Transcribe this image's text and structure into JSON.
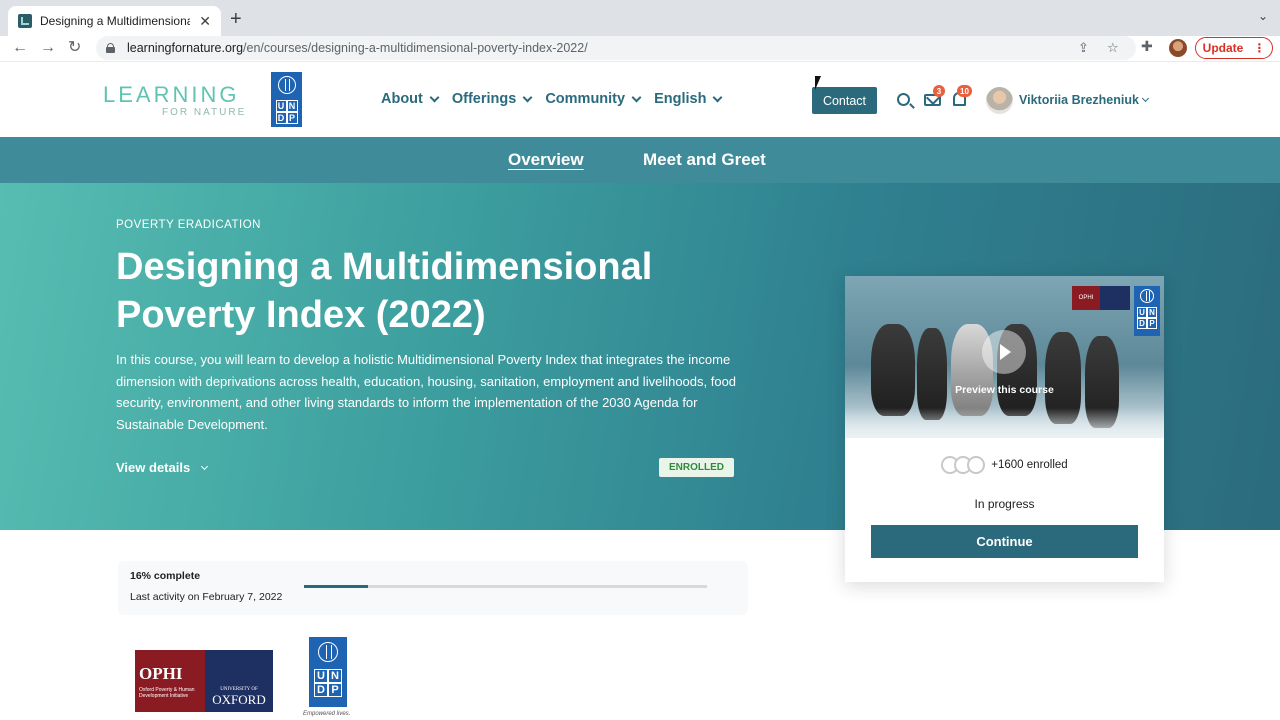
{
  "browser": {
    "tab_title": "Designing a Multidimensional P",
    "close_glyph": "✕",
    "new_tab_glyph": "+",
    "url_host": "learningfornature.org",
    "url_path": "/en/courses/designing-a-multidimensional-poverty-index-2022/",
    "update_label": "Update",
    "menu_glyph": "⋮"
  },
  "header": {
    "logo_line1": "LEARNING",
    "logo_line2": "FOR NATURE",
    "undp_letters": [
      "U",
      "N",
      "D",
      "P"
    ],
    "nav": [
      {
        "label": "About"
      },
      {
        "label": "Offerings"
      },
      {
        "label": "Community"
      },
      {
        "label": "English"
      }
    ],
    "contact_label": "Contact",
    "mail_count": "3",
    "notification_count": "10",
    "user_name": "Viktoriia Brezheniuk"
  },
  "subnav": {
    "overview": "Overview",
    "meet_and_greet": "Meet and Greet"
  },
  "hero": {
    "eyebrow": "POVERTY ERADICATION",
    "title": "Designing a Multidimensional Poverty Index (2022)",
    "description": "In this course, you will learn to develop a holistic Multidimensional Poverty Index that integrates the income dimension with deprivations across health, education, housing, sanitation, employment and livelihoods, food security, environment, and other living standards to inform the implementation of the 2030 Agenda for Sustainable Development.",
    "view_details": "View details",
    "enrolled_badge": "ENROLLED"
  },
  "card": {
    "ophi_text": "OPHI",
    "preview_label": "Preview this course",
    "enrolled_count": "+1600 enrolled",
    "status": "In progress",
    "continue_label": "Continue"
  },
  "progress": {
    "percent_label": "16% complete",
    "percent_value": 0.16,
    "last_activity": "Last activity on February 7, 2022"
  },
  "partners": {
    "ophi": "OPHI",
    "ophi_sub": "Oxford Poverty & Human Development Initiative",
    "oxford_univ": "UNIVERSITY OF",
    "oxford": "OXFORD",
    "undp_tagline": "Empowered lives."
  },
  "colors": {
    "brand_teal": "#2a6a7c",
    "hero_start": "#57bdb2",
    "badge_orange": "#e8603c",
    "undp_blue": "#1f63b3"
  }
}
